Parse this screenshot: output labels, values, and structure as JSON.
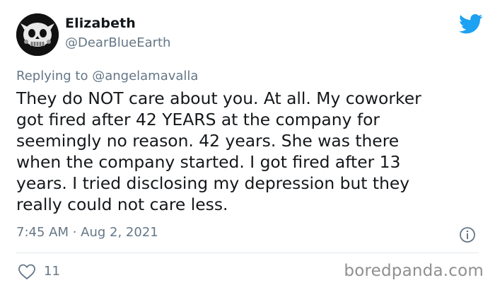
{
  "tweet": {
    "author": {
      "display_name": "Elizabeth",
      "handle": "@DearBlueEarth",
      "avatar_icon": "skull-avatar"
    },
    "reply": {
      "prefix": "Replying to ",
      "handle": "@angelamavalla"
    },
    "text": "They do NOT care about you. At all. My coworker\ngot fired after 42 YEARS at the company for\nseemingly no reason. 42 years. She was there\nwhen the company started. I got fired after 13\nyears. I tried disclosing my depression but they\nreally could not care less.",
    "timestamp": "7:45 AM · Aug 2, 2021",
    "likes": "11"
  },
  "icons": {
    "brand": "twitter-bird-icon",
    "info": "info-icon",
    "like": "heart-icon"
  },
  "colors": {
    "twitter_blue": "#1da1f2",
    "muted_text": "#657786",
    "primary_text": "#14171a"
  },
  "watermark": "boredpanda.com"
}
